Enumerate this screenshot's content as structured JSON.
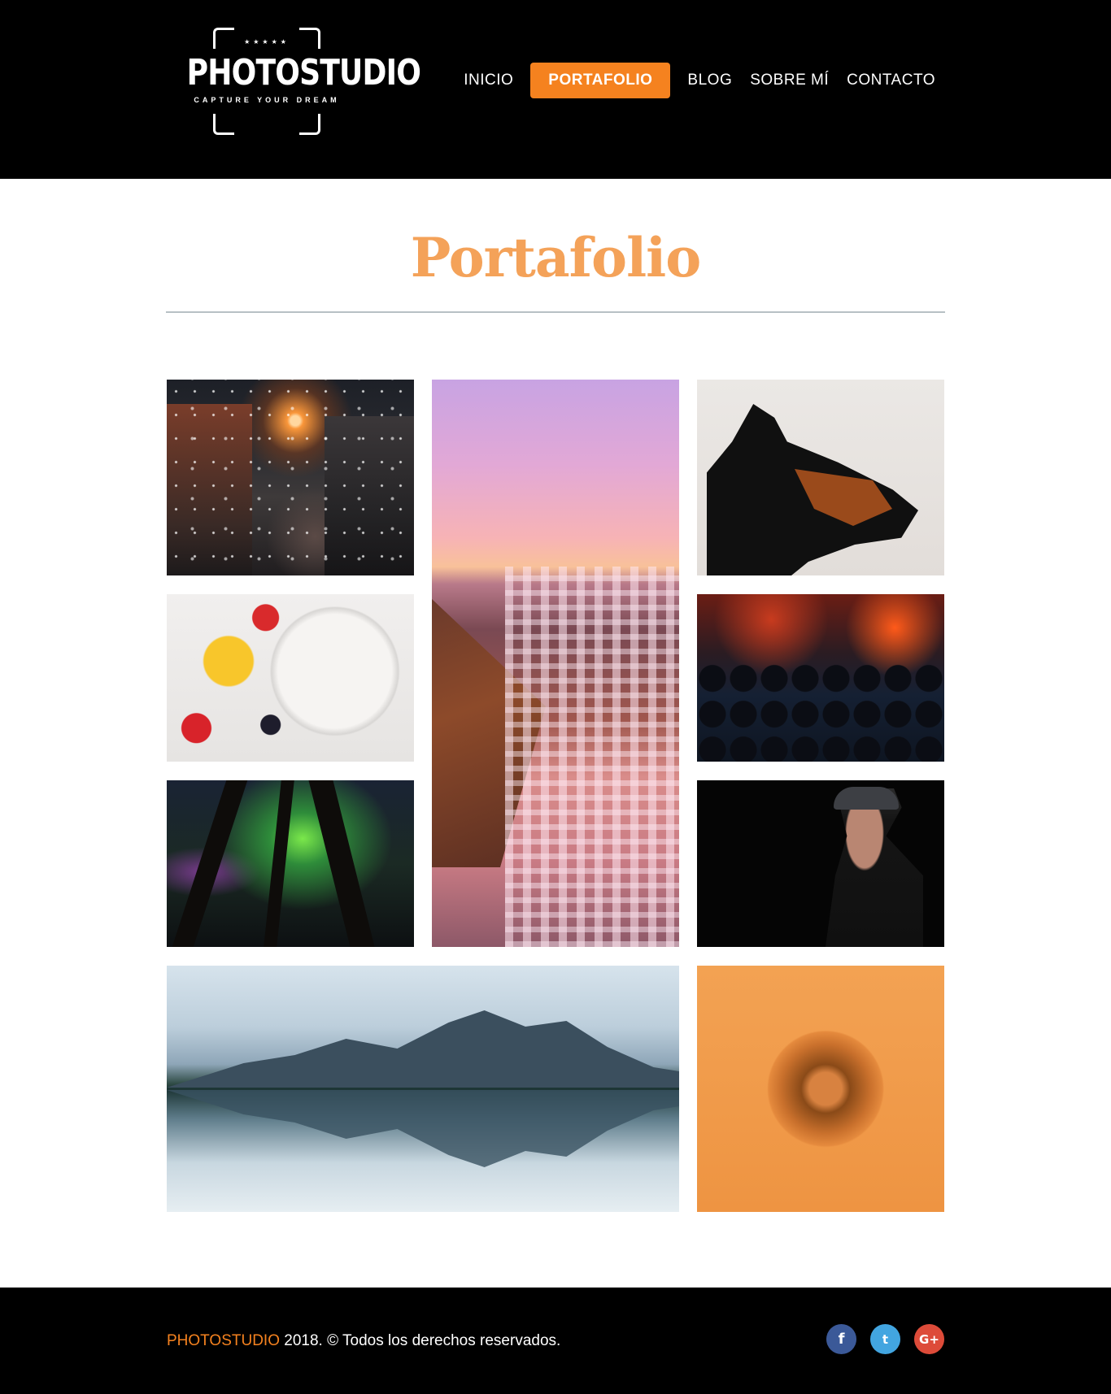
{
  "header": {
    "logo": {
      "stars": "★★★★★",
      "name": "PHOTOSTUDIO",
      "tagline": "CAPTURE YOUR DREAM"
    },
    "nav": [
      {
        "label": "INICIO",
        "active": false
      },
      {
        "label": "PORTAFOLIO",
        "active": true
      },
      {
        "label": "BLOG",
        "active": false
      },
      {
        "label": "SOBRE MÍ",
        "active": false
      },
      {
        "label": "CONTACTO",
        "active": false
      }
    ]
  },
  "main": {
    "title": "Portafolio"
  },
  "gallery": [
    {
      "name": "snowy-street-photo"
    },
    {
      "name": "santorini-village-photo"
    },
    {
      "name": "doberman-dog-photo"
    },
    {
      "name": "fruit-bowl-photo"
    },
    {
      "name": "night-crowd-photo"
    },
    {
      "name": "aurora-forest-photo"
    },
    {
      "name": "woman-in-hat-photo"
    },
    {
      "name": "mountain-lake-reflection-photo"
    },
    {
      "name": "photographer-camera-photo"
    }
  ],
  "footer": {
    "brand": "PHOTOSTUDIO",
    "copyright": " 2018. © Todos los derechos reservados.",
    "social": [
      {
        "icon": "facebook-icon",
        "glyph": "f"
      },
      {
        "icon": "twitter-icon",
        "glyph": "t"
      },
      {
        "icon": "google-plus-icon",
        "glyph": "G+"
      }
    ]
  },
  "colors": {
    "accent": "#f5821f",
    "title": "#f4a259",
    "header_bg": "#000000",
    "facebook": "#3b5998",
    "twitter": "#42a5e0",
    "google_plus": "#dd4b39"
  }
}
